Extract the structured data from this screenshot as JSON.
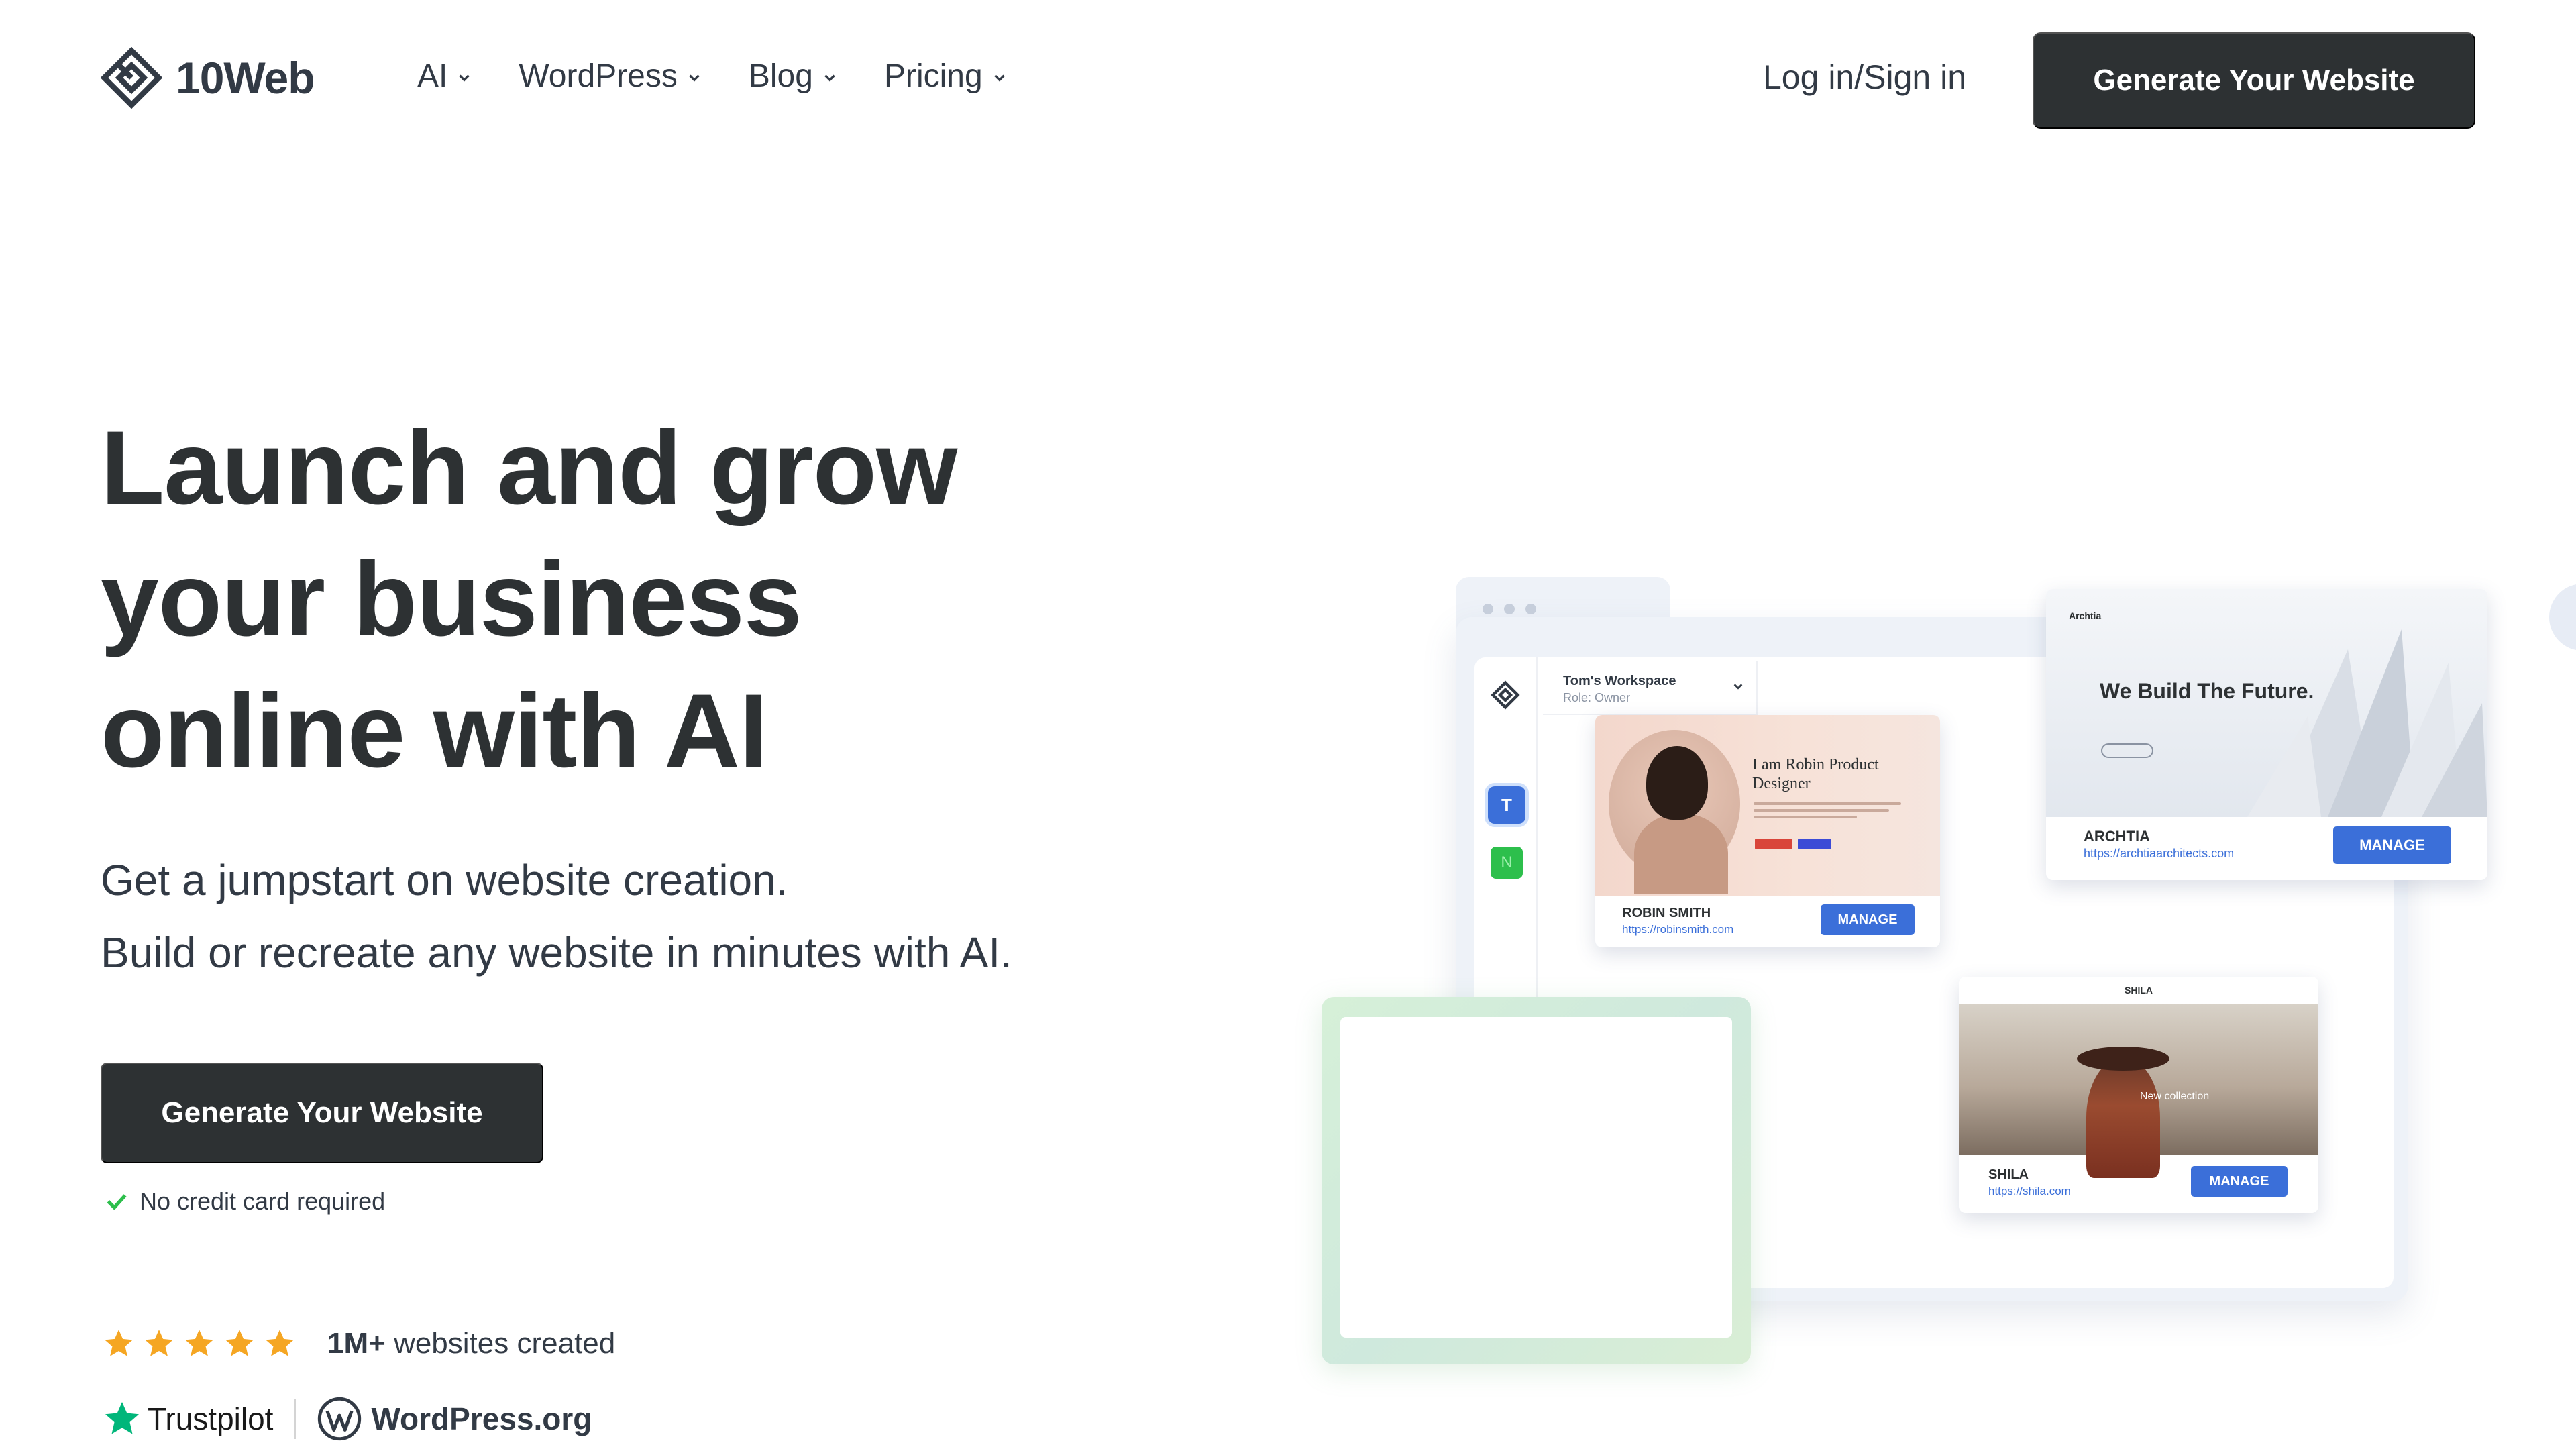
{
  "brand": {
    "name": "10Web"
  },
  "nav": {
    "items": [
      {
        "label": "AI"
      },
      {
        "label": "WordPress"
      },
      {
        "label": "Blog"
      },
      {
        "label": "Pricing"
      }
    ],
    "login": "Log in/Sign in",
    "cta": "Generate Your Website"
  },
  "hero": {
    "title_lines": [
      "Launch and grow",
      "your business",
      "online with AI"
    ],
    "subtitle_lines": [
      "Get a jumpstart on website creation.",
      "Build or recreate any website in minutes with AI."
    ],
    "cta": "Generate Your Website",
    "note": "No credit card required"
  },
  "social_proof": {
    "stars": 5,
    "count": "1M+",
    "count_label": "websites created",
    "trustpilot": "Trustpilot",
    "wordpress": "WordPress.org"
  },
  "illustration": {
    "workspace_name": "Tom's Workspace",
    "workspace_role": "Role: Owner",
    "workspace_badges": [
      "T",
      "N"
    ],
    "sites": [
      {
        "name": "ROBIN SMITH",
        "url": "https://robinsmith.com",
        "action": "MANAGE",
        "headline": "I am Robin Product Designer"
      },
      {
        "name": "ARCHTIA",
        "url": "https://archtiaarchitects.com",
        "action": "MANAGE",
        "headline": "We Build The Future.",
        "logo": "Archtia"
      },
      {
        "name": "SHILA",
        "url": "https://shila.com",
        "action": "MANAGE",
        "brand": "SHILA",
        "overlay": "New collection"
      }
    ]
  },
  "colors": {
    "dark": "#2d3133",
    "accent_blue": "#3b6fd9",
    "star": "#f5a623",
    "trustpilot_green": "#00b67a",
    "check_green": "#2dbf4c"
  },
  "icons": {
    "logo": "10web-diamond-logo-icon",
    "chevron": "chevron-down-icon",
    "check": "check-icon",
    "star": "star-icon",
    "trustpilot": "trustpilot-star-icon",
    "wordpress": "wordpress-logo-icon"
  }
}
